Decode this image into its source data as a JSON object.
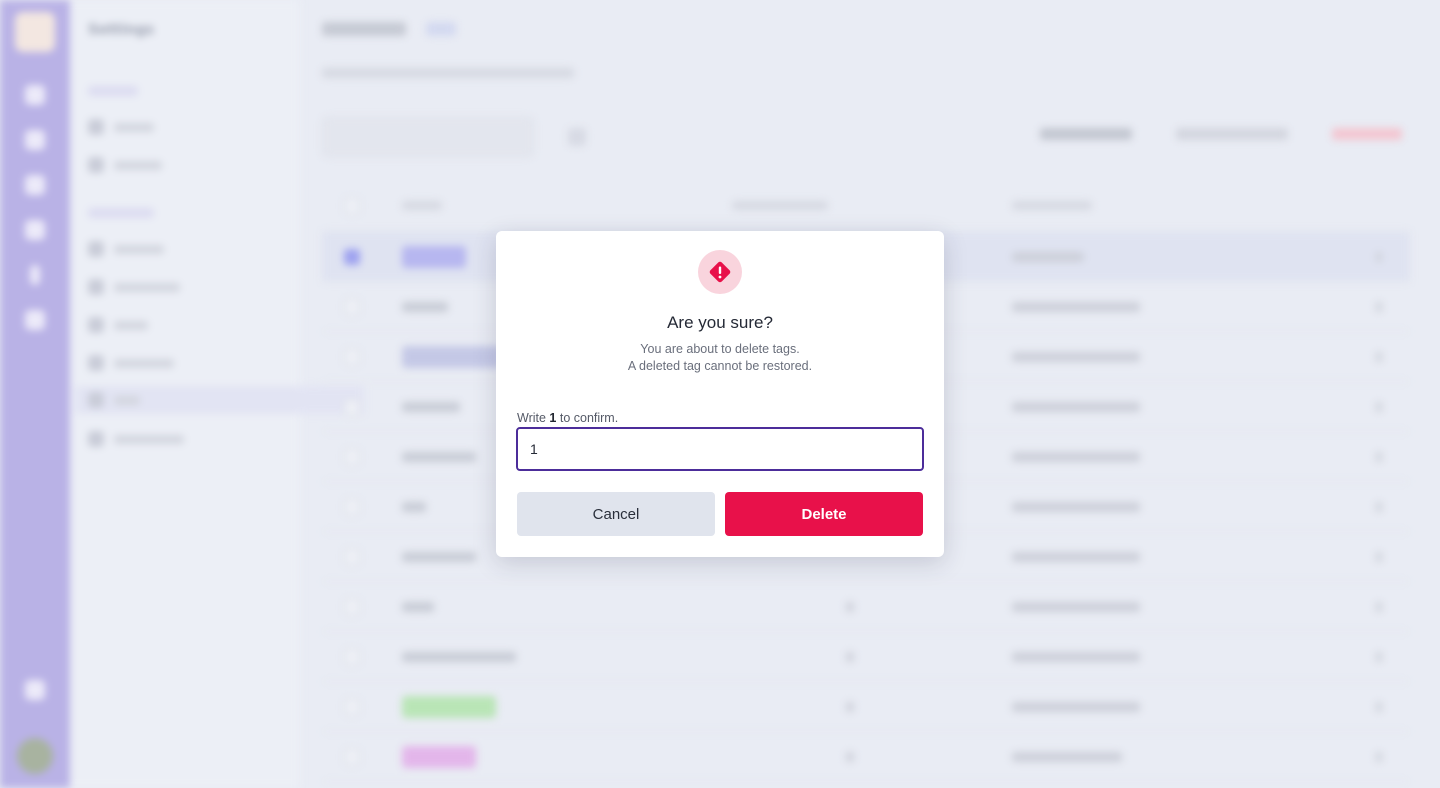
{
  "background": {
    "settings_title": "Settings",
    "subnav": {
      "sections": [
        "",
        ""
      ],
      "items": [
        "",
        "",
        "",
        "",
        "",
        "",
        "",
        ""
      ]
    },
    "breadcrumbs": [
      "",
      ""
    ],
    "table_rows": 11
  },
  "modal": {
    "icon": "warning-diamond-icon",
    "title": "Are you sure?",
    "description_line1": "You are about to delete tags.",
    "description_line2": "A deleted tag cannot be restored.",
    "confirm_prefix": "Write ",
    "confirm_value": "1",
    "confirm_suffix": " to confirm.",
    "input_value": "1",
    "cancel_label": "Cancel",
    "delete_label": "Delete"
  },
  "colors": {
    "accent": "#4c2d9a",
    "danger": "#e8114a",
    "danger_soft": "#f9d4dd",
    "cancel_bg": "#e0e4ed"
  }
}
